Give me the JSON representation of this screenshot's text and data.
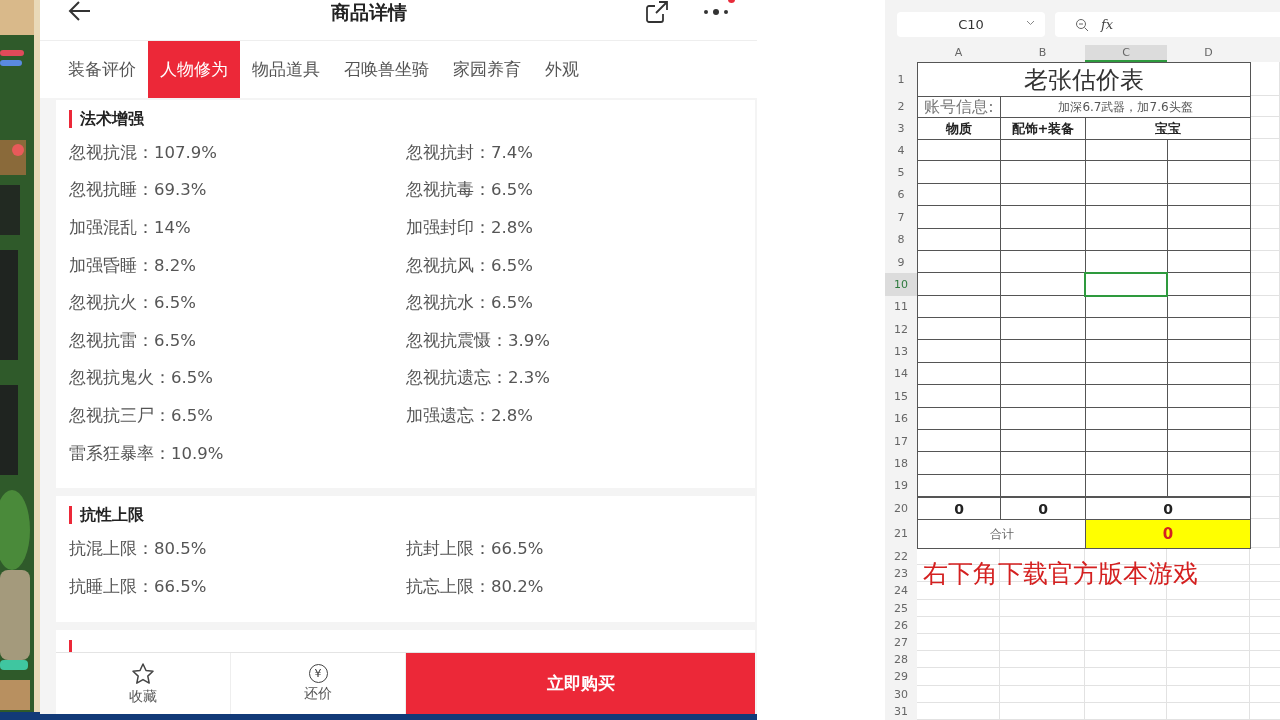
{
  "app": {
    "title": "商品详情",
    "tabs": [
      {
        "label": "装备评价",
        "selected": false
      },
      {
        "label": "人物修为",
        "selected": true
      },
      {
        "label": "物品道具",
        "selected": false
      },
      {
        "label": "召唤兽坐骑",
        "selected": false
      },
      {
        "label": "家园养育",
        "selected": false
      },
      {
        "label": "外观",
        "selected": false
      }
    ],
    "sections": [
      {
        "title": "法术增强",
        "items": [
          "忽视抗混：107.9%",
          "忽视抗封：7.4%",
          "忽视抗睡：69.3%",
          "忽视抗毒：6.5%",
          "加强混乱：14%",
          "加强封印：2.8%",
          "加强昏睡：8.2%",
          "忽视抗风：6.5%",
          "忽视抗火：6.5%",
          "忽视抗水：6.5%",
          "忽视抗雷：6.5%",
          "忽视抗震慑：3.9%",
          "忽视抗鬼火：6.5%",
          "忽视抗遗忘：2.3%",
          "忽视抗三尸：6.5%",
          "加强遗忘：2.8%",
          "雷系狂暴率：10.9%"
        ]
      },
      {
        "title": "抗性上限",
        "items": [
          "抗混上限：80.5%",
          "抗封上限：66.5%",
          "抗睡上限：66.5%",
          "抗忘上限：80.2%"
        ]
      }
    ],
    "bottom_bar": {
      "favorite": "收藏",
      "bargain": "还价",
      "bargain_icon": "¥",
      "buy": "立即购买"
    }
  },
  "sheet": {
    "name_box": "C10",
    "formula_label": "fx",
    "columns": [
      {
        "label": "A",
        "selected": false
      },
      {
        "label": "B",
        "selected": false
      },
      {
        "label": "C",
        "selected": true
      },
      {
        "label": "D",
        "selected": false
      }
    ],
    "row_numbers": [
      {
        "label": "1",
        "selected": false
      },
      {
        "label": "2",
        "selected": false
      },
      {
        "label": "3",
        "selected": false
      },
      {
        "label": "4",
        "selected": false
      },
      {
        "label": "5",
        "selected": false
      },
      {
        "label": "6",
        "selected": false
      },
      {
        "label": "7",
        "selected": false
      },
      {
        "label": "8",
        "selected": false
      },
      {
        "label": "9",
        "selected": false
      },
      {
        "label": "10",
        "selected": true
      },
      {
        "label": "11",
        "selected": false
      },
      {
        "label": "12",
        "selected": false
      },
      {
        "label": "13",
        "selected": false
      },
      {
        "label": "14",
        "selected": false
      },
      {
        "label": "15",
        "selected": false
      },
      {
        "label": "16",
        "selected": false
      },
      {
        "label": "17",
        "selected": false
      },
      {
        "label": "18",
        "selected": false
      },
      {
        "label": "19",
        "selected": false
      },
      {
        "label": "20",
        "selected": false
      },
      {
        "label": "21",
        "selected": false
      },
      {
        "label": "22",
        "selected": false
      },
      {
        "label": "23",
        "selected": false
      },
      {
        "label": "24",
        "selected": false
      },
      {
        "label": "25",
        "selected": false
      },
      {
        "label": "26",
        "selected": false
      },
      {
        "label": "27",
        "selected": false
      },
      {
        "label": "28",
        "selected": false
      },
      {
        "label": "29",
        "selected": false
      },
      {
        "label": "30",
        "selected": false
      },
      {
        "label": "31",
        "selected": false
      }
    ],
    "title": "老张估价表",
    "account_label": "账号信息:",
    "account_value": "加深6.7武器，加7.6头盔",
    "headers": [
      "物质",
      "配饰+装备",
      "宝宝"
    ],
    "totals": [
      "0",
      "0",
      "0"
    ],
    "total_label": "合计",
    "total_value": "0",
    "notice": "右下角下载官方版本游戏"
  }
}
